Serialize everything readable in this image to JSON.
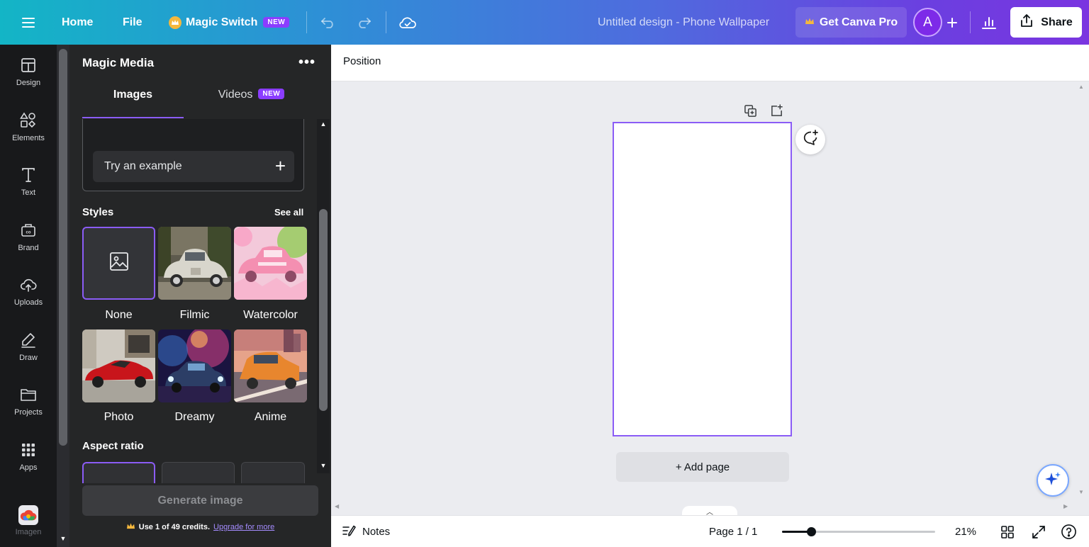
{
  "topbar": {
    "home": "Home",
    "file": "File",
    "magic_switch": "Magic Switch",
    "magic_switch_badge": "NEW",
    "doc_title": "Untitled design - Phone Wallpaper",
    "get_pro": "Get Canva Pro",
    "avatar_initial": "A",
    "share": "Share"
  },
  "leftnav": {
    "items": [
      {
        "label": "Design",
        "icon": "layout-icon"
      },
      {
        "label": "Elements",
        "icon": "shapes-icon"
      },
      {
        "label": "Text",
        "icon": "text-icon"
      },
      {
        "label": "Brand",
        "icon": "briefcase-icon"
      },
      {
        "label": "Uploads",
        "icon": "cloud-upload-icon"
      },
      {
        "label": "Draw",
        "icon": "pen-icon"
      },
      {
        "label": "Projects",
        "icon": "folder-icon"
      },
      {
        "label": "Apps",
        "icon": "grid-icon"
      },
      {
        "label": "Imagen",
        "icon": "imagen-logo"
      }
    ]
  },
  "panel": {
    "title": "Magic Media",
    "tabs": [
      {
        "label": "Images",
        "active": true
      },
      {
        "label": "Videos",
        "badge": "NEW",
        "active": false
      }
    ],
    "try_example": "Try an example",
    "styles_label": "Styles",
    "see_all": "See all",
    "styles": [
      {
        "label": "None",
        "selected": true
      },
      {
        "label": "Filmic",
        "selected": false
      },
      {
        "label": "Watercolor",
        "selected": false
      },
      {
        "label": "Photo",
        "selected": false
      },
      {
        "label": "Dreamy",
        "selected": false
      },
      {
        "label": "Anime",
        "selected": false
      }
    ],
    "aspect_ratio_label": "Aspect ratio",
    "generate": "Generate image",
    "credits_text": "Use 1 of 49 credits.",
    "credits_link": "Upgrade for more"
  },
  "toolbar": {
    "position": "Position"
  },
  "canvas": {
    "add_page": "+ Add page"
  },
  "bottombar": {
    "notes": "Notes",
    "page_indicator": "Page 1 / 1",
    "zoom": "21%",
    "zoom_fraction": 0.19
  },
  "colors": {
    "accent": "#8b5cf6",
    "panel_bg": "#252627",
    "nav_bg": "#18191b"
  }
}
